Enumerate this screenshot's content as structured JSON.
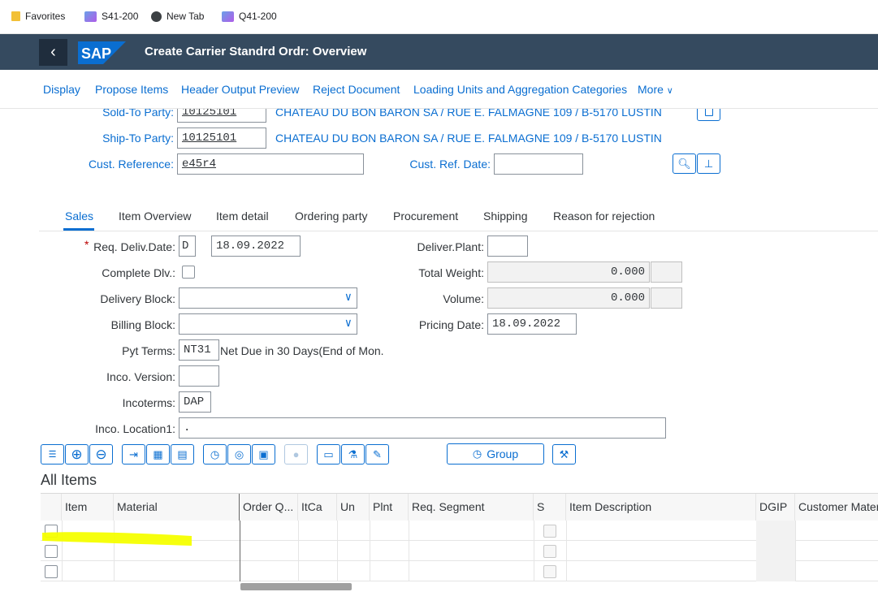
{
  "favorites_bar": {
    "items": [
      {
        "label": "Favorites",
        "icon": "folder-icon"
      },
      {
        "label": "S41-200",
        "icon": "sap-page-icon"
      },
      {
        "label": "New Tab",
        "icon": "globe-icon"
      },
      {
        "label": "Q41-200",
        "icon": "sap-page-icon"
      }
    ]
  },
  "shell": {
    "logo": "SAP",
    "title": "Create Carrier Standrd Ordr: Overview"
  },
  "toolbar": {
    "items": [
      "Display",
      "Propose Items",
      "Header Output Preview",
      "Reject Document",
      "Loading Units and Aggregation Categories",
      "More"
    ]
  },
  "header": {
    "sold_to": {
      "label": "Sold-To Party:",
      "value": "10125101",
      "text": "CHATEAU DU BON BARON SA / RUE E. FALMAGNE 109 / B-5170 LUSTIN"
    },
    "ship_to": {
      "label": "Ship-To Party:",
      "value": "10125101",
      "text": "CHATEAU DU BON BARON SA / RUE E. FALMAGNE 109 / B-5170 LUSTIN"
    },
    "cust_ref": {
      "label": "Cust. Reference:",
      "value": "e45r4"
    },
    "cust_ref_date": {
      "label": "Cust. Ref. Date:",
      "value": ""
    }
  },
  "tabs": [
    "Sales",
    "Item Overview",
    "Item detail",
    "Ordering party",
    "Procurement",
    "Shipping",
    "Reason for rejection"
  ],
  "sales": {
    "req_deliv_date": {
      "label": "Req. Deliv.Date:",
      "type": "D",
      "value": "18.09.2022"
    },
    "complete_dlv": {
      "label": "Complete Dlv.:"
    },
    "delivery_block": {
      "label": "Delivery Block:",
      "value": ""
    },
    "billing_block": {
      "label": "Billing Block:",
      "value": ""
    },
    "pyt_terms": {
      "label": "Pyt Terms:",
      "value": "NT31",
      "text": "Net Due in 30 Days(End of Mon."
    },
    "inco_version": {
      "label": "Inco. Version:",
      "value": ""
    },
    "incoterms": {
      "label": "Incoterms:",
      "value": "DAP"
    },
    "inco_location": {
      "label": "Inco. Location1:",
      "value": "."
    },
    "deliver_plant": {
      "label": "Deliver.Plant:",
      "value": ""
    },
    "total_weight": {
      "label": "Total Weight:",
      "value": "0.000",
      "unit": ""
    },
    "volume": {
      "label": "Volume:",
      "value": "0.000",
      "unit": ""
    },
    "pricing_date": {
      "label": "Pricing Date:",
      "value": "18.09.2022"
    }
  },
  "item_toolbar": {
    "group_label": "Group"
  },
  "items_table": {
    "title": "All Items",
    "columns": [
      "Item",
      "Material",
      "Order Q...",
      "ItCa",
      "Un",
      "Plnt",
      "Req. Segment",
      "S",
      "Item Description",
      "DGIP",
      "Customer Mater"
    ],
    "rows": [
      {
        "item": "",
        "material": ""
      },
      {
        "item": "",
        "material": ""
      },
      {
        "item": "",
        "material": ""
      }
    ]
  },
  "colors": {
    "shell": "#354a5f",
    "link": "#0a6ed1",
    "highlight": "#f5ff00"
  }
}
